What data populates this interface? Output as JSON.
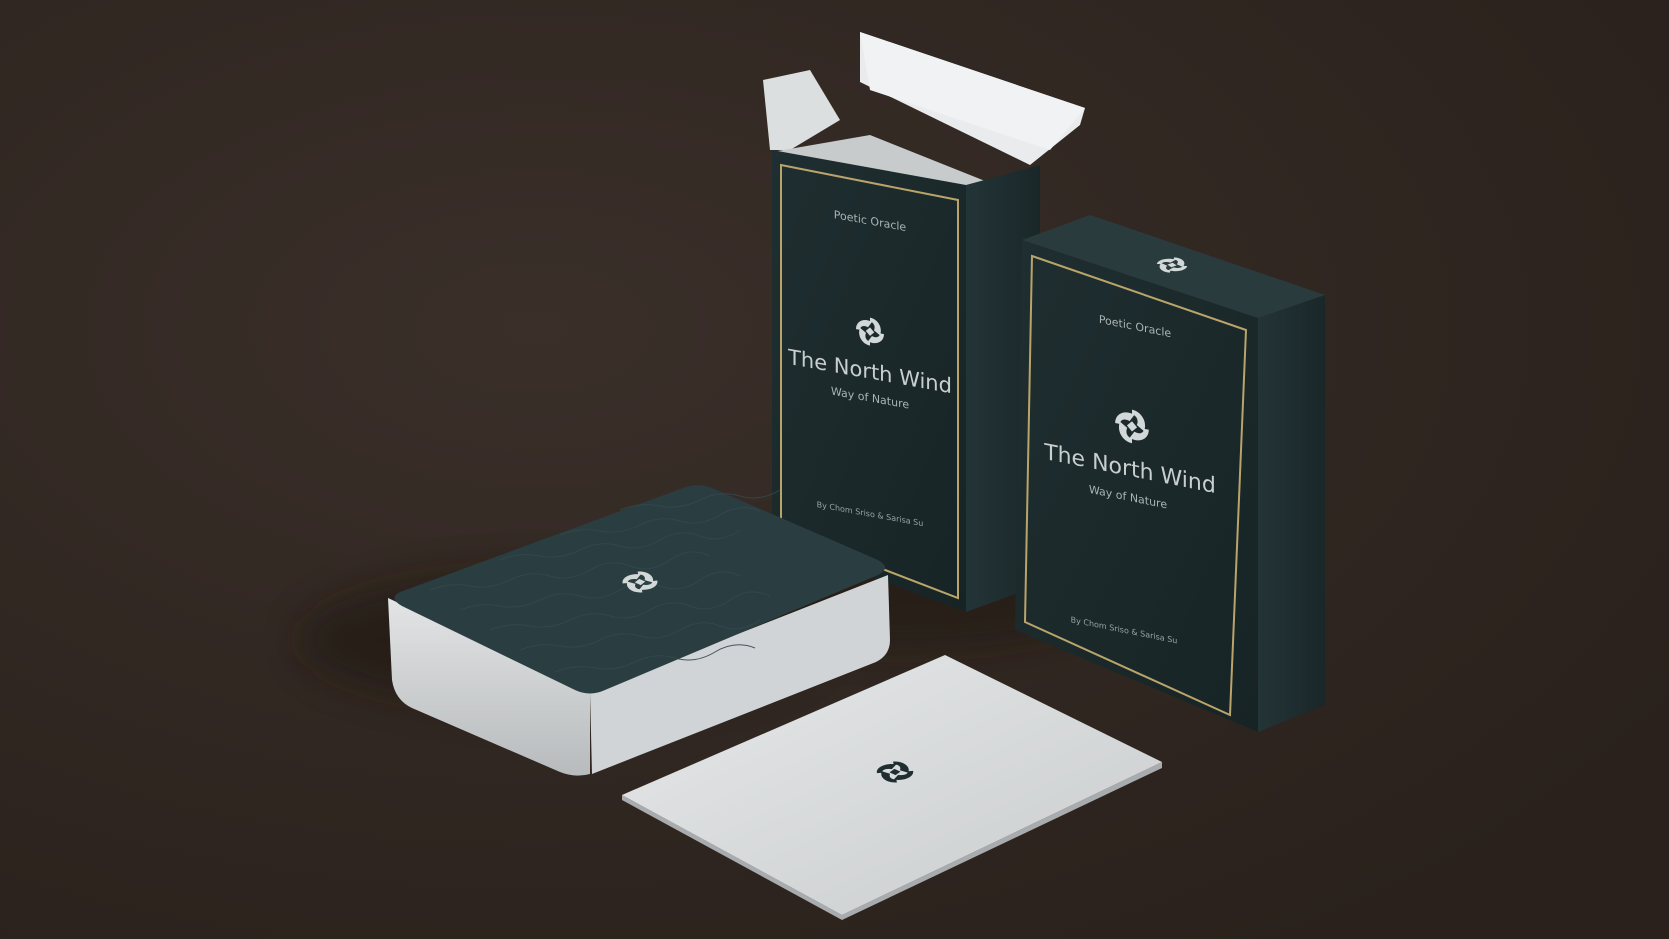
{
  "colors": {
    "background": "#2f2621",
    "box_front": "#1c2a2c",
    "box_side": "#223235",
    "box_top": "#2a3b3e",
    "gold_border": "#b9a46a",
    "card_white": "#dcdedf",
    "card_edge": "#bfc2c4",
    "card_back": "#2a3d41",
    "text_light": "#c9cfcf",
    "emblem": "#d2d7d7"
  },
  "box_open": {
    "label_top": "Poetic Oracle",
    "title": "The North Wind",
    "subtitle": "Way of Nature",
    "authors": "By Chom Sriso & Sarisa Su"
  },
  "box_closed": {
    "label_top": "Poetic Oracle",
    "title": "The North Wind",
    "subtitle": "Way of Nature",
    "authors": "By Chom Sriso & Sarisa Su"
  },
  "icons": {
    "emblem": "wind-swirl-icon"
  }
}
